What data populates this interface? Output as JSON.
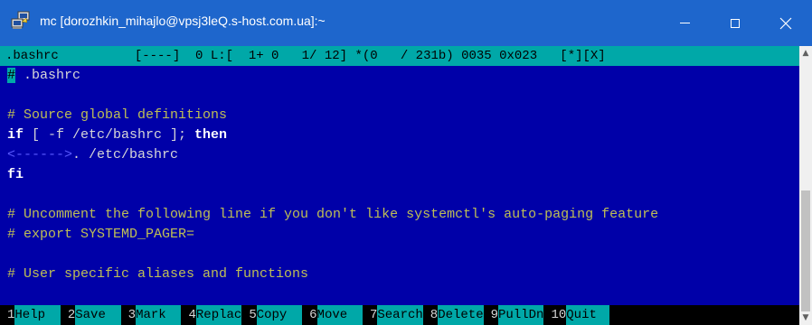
{
  "window": {
    "title": "mc [dorozhkin_mihajlo@vpsj3leQ.s-host.com.ua]:~",
    "icon": "putty-icon",
    "controls": [
      "minimize-icon",
      "maximize-icon",
      "close-icon"
    ]
  },
  "editor": {
    "status_line": ".bashrc          [----]  0 L:[  1+ 0   1/ 12] *(0   / 231b) 0035 0x023   [*][X]",
    "lines": [
      {
        "cursor": "#",
        "text": " .bashrc"
      },
      {
        "text": ""
      },
      {
        "text": "# Source global definitions"
      },
      {
        "keyword": "if",
        "text": " [ -f /etc/bashrc ]; ",
        "keyword2": "then"
      },
      {
        "tab": "<------>",
        "text": ". /etc/bashrc"
      },
      {
        "keyword": "fi"
      },
      {
        "text": ""
      },
      {
        "text": "# Uncomment the following line if you don't like systemctl's auto-paging feature"
      },
      {
        "text": "# export SYSTEMD_PAGER="
      },
      {
        "text": ""
      },
      {
        "text": "# User specific aliases and functions"
      }
    ]
  },
  "function_keys": [
    {
      "num": "1",
      "label": "Help  "
    },
    {
      "num": "2",
      "label": "Save  "
    },
    {
      "num": "3",
      "label": "Mark  "
    },
    {
      "num": "4",
      "label": "Replac"
    },
    {
      "num": "5",
      "label": "Copy  "
    },
    {
      "num": "6",
      "label": "Move  "
    },
    {
      "num": "7",
      "label": "Search"
    },
    {
      "num": "8",
      "label": "Delete"
    },
    {
      "num": "9",
      "label": "PullDn"
    },
    {
      "num": "10",
      "label": "Quit"
    }
  ],
  "colors": {
    "titlebar": "#1e66cc",
    "editor_background": "#0000a8",
    "status_background": "#00a8a8",
    "text": "#d7d7d7",
    "keyword": "#ffffff"
  }
}
